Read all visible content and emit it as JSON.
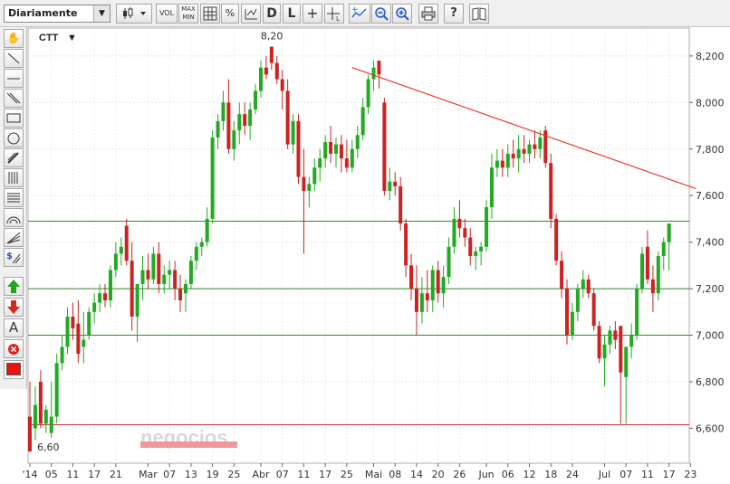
{
  "toolbar": {
    "period_select": "Diariamente",
    "buttons": [
      {
        "name": "candle-type-button",
        "label": "",
        "icon": "candlestick-icon"
      },
      {
        "name": "volume-button",
        "label": "VOL"
      },
      {
        "name": "maxmin-button",
        "label": "MAX MIN"
      },
      {
        "name": "grid-button",
        "label": "",
        "icon": "grid-icon"
      },
      {
        "name": "percent-button",
        "label": "%"
      },
      {
        "name": "indicator-button",
        "label": "",
        "icon": "indicator-icon"
      },
      {
        "name": "d-button",
        "label": "D"
      },
      {
        "name": "l-button",
        "label": "L"
      },
      {
        "name": "crosshair-button",
        "label": "+"
      },
      {
        "name": "measure-button",
        "label": "",
        "icon": "measure-icon"
      },
      {
        "name": "zoom-area-button",
        "label": "",
        "icon": "zoom-area-icon"
      },
      {
        "name": "zoom-out-button",
        "label": "",
        "icon": "zoom-out-icon"
      },
      {
        "name": "zoom-in-button",
        "label": "",
        "icon": "zoom-in-icon"
      },
      {
        "name": "print-button",
        "label": "",
        "icon": "printer-icon"
      },
      {
        "name": "help-button",
        "label": "?"
      },
      {
        "name": "book-button",
        "label": "",
        "icon": "book-icon"
      }
    ]
  },
  "sidebar": {
    "tools": [
      "hand-icon",
      "diagonal-line-icon",
      "horizontal-line-icon",
      "channel-icon",
      "rectangle-icon",
      "ellipse-icon",
      "pencil-icon",
      "fibonacci-icon",
      "retracement-icon",
      "arc-icon",
      "fan-icon",
      "dollar-icon",
      "arrow-up-icon",
      "arrow-down-icon",
      "text-icon",
      "delete-icon",
      "color-swatch-icon"
    ],
    "text_label": "A",
    "dollar_label": "$",
    "color": "#ee1111"
  },
  "chart_data": {
    "type": "candlestick",
    "ticker": "CTT",
    "high_label": "8,20",
    "low_label": "6,60",
    "watermark": "negocios",
    "ylim": [
      6.45,
      8.32
    ],
    "y_ticks": [
      "8,200",
      "8,000",
      "7,800",
      "7,600",
      "7,400",
      "7,200",
      "7,000",
      "6,800",
      "6,600"
    ],
    "y_tick_values": [
      8.2,
      8.0,
      7.8,
      7.6,
      7.4,
      7.2,
      7.0,
      6.8,
      6.6
    ],
    "x_ticks": [
      "'14",
      "05",
      "11",
      "17",
      "21",
      "Mar",
      "07",
      "13",
      "19",
      "25",
      "Abr",
      "07",
      "11",
      "17",
      "25",
      "Mai",
      "08",
      "14",
      "20",
      "26",
      "Jun",
      "06",
      "12",
      "18",
      "24",
      "Jul",
      "07",
      "11",
      "17",
      "23"
    ],
    "x_tick_index": [
      0,
      4,
      8,
      12,
      16,
      22,
      26,
      30,
      34,
      38,
      43,
      47,
      51,
      55,
      59,
      64,
      68,
      72,
      76,
      80,
      85,
      89,
      93,
      97,
      101,
      107,
      111,
      115,
      119,
      123
    ],
    "hlines": [
      {
        "value": 7.49,
        "color": "#2e8b2e"
      },
      {
        "value": 7.2,
        "color": "#2e8b2e"
      },
      {
        "value": 7.0,
        "color": "#2e8b2e"
      },
      {
        "value": 6.615,
        "color": "#cc3333"
      }
    ],
    "trendline": {
      "from": {
        "i": 60,
        "v": 8.15
      },
      "to": {
        "i": 124,
        "v": 7.63
      },
      "color": "#e83a2c"
    },
    "up_color": "#22aa22",
    "down_color": "#cc2222",
    "candles": [
      [
        6.65,
        6.8,
        6.5,
        6.5
      ],
      [
        6.6,
        6.78,
        6.55,
        6.7
      ],
      [
        6.8,
        6.85,
        6.6,
        6.62
      ],
      [
        6.62,
        6.7,
        6.58,
        6.68
      ],
      [
        6.58,
        6.8,
        6.56,
        6.65
      ],
      [
        6.65,
        6.92,
        6.62,
        6.88
      ],
      [
        6.88,
        7.0,
        6.85,
        6.95
      ],
      [
        6.95,
        7.12,
        6.92,
        7.08
      ],
      [
        7.08,
        7.14,
        6.98,
        7.03
      ],
      [
        7.05,
        7.15,
        6.88,
        6.92
      ],
      [
        6.95,
        7.1,
        6.88,
        6.98
      ],
      [
        7.0,
        7.12,
        6.98,
        7.1
      ],
      [
        7.1,
        7.18,
        7.05,
        7.14
      ],
      [
        7.14,
        7.22,
        7.1,
        7.18
      ],
      [
        7.18,
        7.22,
        7.12,
        7.15
      ],
      [
        7.15,
        7.3,
        7.12,
        7.28
      ],
      [
        7.28,
        7.4,
        7.25,
        7.35
      ],
      [
        7.35,
        7.42,
        7.3,
        7.38
      ],
      [
        7.47,
        7.5,
        7.3,
        7.32
      ],
      [
        7.32,
        7.4,
        7.02,
        7.08
      ],
      [
        7.08,
        7.22,
        6.97,
        7.22
      ],
      [
        7.22,
        7.34,
        7.15,
        7.28
      ],
      [
        7.28,
        7.35,
        7.2,
        7.24
      ],
      [
        7.24,
        7.38,
        7.22,
        7.35
      ],
      [
        7.35,
        7.4,
        7.18,
        7.22
      ],
      [
        7.22,
        7.3,
        7.18,
        7.26
      ],
      [
        7.26,
        7.32,
        7.2,
        7.28
      ],
      [
        7.28,
        7.32,
        7.15,
        7.2
      ],
      [
        7.2,
        7.26,
        7.1,
        7.15
      ],
      [
        7.18,
        7.24,
        7.1,
        7.22
      ],
      [
        7.22,
        7.34,
        7.2,
        7.32
      ],
      [
        7.32,
        7.4,
        7.28,
        7.38
      ],
      [
        7.38,
        7.42,
        7.34,
        7.4
      ],
      [
        7.4,
        7.55,
        7.38,
        7.5
      ],
      [
        7.5,
        7.88,
        7.48,
        7.85
      ],
      [
        7.85,
        7.95,
        7.8,
        7.92
      ],
      [
        7.92,
        8.05,
        7.88,
        8.0
      ],
      [
        8.0,
        8.1,
        7.78,
        7.8
      ],
      [
        7.8,
        7.92,
        7.75,
        7.88
      ],
      [
        7.88,
        8.0,
        7.82,
        7.95
      ],
      [
        7.95,
        8.0,
        7.86,
        7.9
      ],
      [
        7.9,
        8.0,
        7.84,
        7.97
      ],
      [
        7.97,
        8.08,
        7.95,
        8.05
      ],
      [
        8.05,
        8.18,
        8.02,
        8.15
      ],
      [
        8.15,
        8.2,
        8.1,
        8.12
      ],
      [
        8.24,
        8.24,
        8.14,
        8.17
      ],
      [
        8.17,
        8.2,
        8.08,
        8.1
      ],
      [
        8.1,
        8.14,
        7.97,
        8.05
      ],
      [
        8.05,
        8.1,
        7.8,
        7.82
      ],
      [
        7.82,
        7.95,
        7.78,
        7.92
      ],
      [
        7.92,
        7.95,
        7.65,
        7.68
      ],
      [
        7.68,
        7.8,
        7.35,
        7.62
      ],
      [
        7.62,
        7.68,
        7.55,
        7.65
      ],
      [
        7.65,
        7.76,
        7.62,
        7.72
      ],
      [
        7.72,
        7.8,
        7.66,
        7.76
      ],
      [
        7.76,
        7.86,
        7.72,
        7.83
      ],
      [
        7.83,
        7.9,
        7.74,
        7.78
      ],
      [
        7.78,
        7.85,
        7.72,
        7.82
      ],
      [
        7.82,
        7.86,
        7.7,
        7.76
      ],
      [
        7.76,
        7.84,
        7.7,
        7.72
      ],
      [
        7.72,
        7.84,
        7.7,
        7.8
      ],
      [
        7.8,
        7.9,
        7.76,
        7.86
      ],
      [
        7.86,
        8.02,
        7.84,
        7.98
      ],
      [
        7.98,
        8.12,
        7.95,
        8.1
      ],
      [
        8.1,
        8.18,
        8.05,
        8.15
      ],
      [
        8.18,
        8.18,
        8.06,
        8.12
      ],
      [
        8.0,
        8.02,
        7.6,
        7.62
      ],
      [
        7.62,
        7.72,
        7.58,
        7.66
      ],
      [
        7.66,
        7.7,
        7.6,
        7.64
      ],
      [
        7.64,
        7.68,
        7.45,
        7.48
      ],
      [
        7.48,
        7.5,
        7.25,
        7.3
      ],
      [
        7.3,
        7.35,
        7.15,
        7.2
      ],
      [
        7.2,
        7.3,
        7.0,
        7.1
      ],
      [
        7.1,
        7.25,
        7.05,
        7.18
      ],
      [
        7.18,
        7.28,
        7.1,
        7.15
      ],
      [
        7.15,
        7.3,
        7.1,
        7.28
      ],
      [
        7.28,
        7.32,
        7.14,
        7.18
      ],
      [
        7.18,
        7.3,
        7.12,
        7.25
      ],
      [
        7.25,
        7.42,
        7.22,
        7.38
      ],
      [
        7.38,
        7.55,
        7.35,
        7.5
      ],
      [
        7.5,
        7.58,
        7.42,
        7.46
      ],
      [
        7.46,
        7.5,
        7.38,
        7.42
      ],
      [
        7.42,
        7.46,
        7.3,
        7.34
      ],
      [
        7.34,
        7.38,
        7.28,
        7.36
      ],
      [
        7.36,
        7.4,
        7.3,
        7.38
      ],
      [
        7.38,
        7.58,
        7.36,
        7.55
      ],
      [
        7.55,
        7.78,
        7.5,
        7.72
      ],
      [
        7.72,
        7.8,
        7.68,
        7.75
      ],
      [
        7.75,
        7.8,
        7.68,
        7.72
      ],
      [
        7.72,
        7.82,
        7.68,
        7.78
      ],
      [
        7.78,
        7.84,
        7.72,
        7.76
      ],
      [
        7.76,
        7.86,
        7.7,
        7.8
      ],
      [
        7.8,
        7.86,
        7.74,
        7.78
      ],
      [
        7.78,
        7.84,
        7.74,
        7.82
      ],
      [
        7.82,
        7.88,
        7.76,
        7.8
      ],
      [
        7.8,
        7.88,
        7.76,
        7.85
      ],
      [
        7.88,
        7.9,
        7.72,
        7.74
      ],
      [
        7.74,
        7.78,
        7.46,
        7.5
      ],
      [
        7.5,
        7.52,
        7.3,
        7.32
      ],
      [
        7.32,
        7.36,
        7.16,
        7.2
      ],
      [
        7.2,
        7.24,
        6.96,
        7.0
      ],
      [
        7.0,
        7.14,
        6.98,
        7.1
      ],
      [
        7.1,
        7.22,
        7.06,
        7.2
      ],
      [
        7.2,
        7.28,
        7.16,
        7.24
      ],
      [
        7.24,
        7.26,
        7.16,
        7.18
      ],
      [
        7.18,
        7.2,
        7.02,
        7.04
      ],
      [
        7.04,
        7.06,
        6.88,
        6.9
      ],
      [
        6.9,
        7.0,
        6.78,
        6.96
      ],
      [
        6.96,
        7.04,
        6.92,
        7.02
      ],
      [
        7.02,
        7.06,
        6.94,
        6.98
      ],
      [
        7.04,
        7.04,
        6.62,
        6.84
      ],
      [
        6.82,
        6.95,
        6.62,
        6.95
      ],
      [
        6.95,
        7.05,
        6.9,
        7.0
      ],
      [
        7.0,
        7.22,
        6.98,
        7.2
      ],
      [
        7.2,
        7.38,
        7.18,
        7.35
      ],
      [
        7.38,
        7.45,
        7.22,
        7.24
      ],
      [
        7.24,
        7.3,
        7.1,
        7.18
      ],
      [
        7.18,
        7.36,
        7.15,
        7.34
      ],
      [
        7.34,
        7.42,
        7.28,
        7.4
      ],
      [
        7.4,
        7.45,
        7.28,
        7.48
      ]
    ]
  }
}
